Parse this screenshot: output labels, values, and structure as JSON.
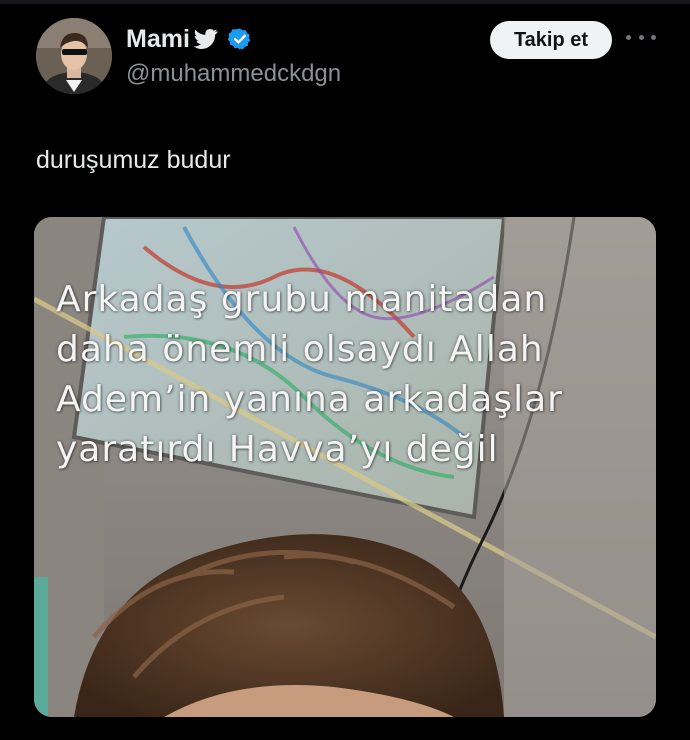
{
  "author": {
    "name": "Mami",
    "handle": "@muhammedckdgn",
    "verified": true,
    "emoji_icon": "bird-icon",
    "verified_icon": "verified-badge-icon"
  },
  "actions": {
    "follow_label": "Takip et",
    "more_icon": "more-options-icon"
  },
  "tweet": {
    "text": "duruşumuz budur",
    "media_caption_lines": [
      "Arkadaş grubu manitadan",
      "daha önemli olsaydı Allah",
      "Adem’in yanına arkadaşlar",
      "yaratırdı Havva’yı değil"
    ]
  },
  "colors": {
    "background": "#000000",
    "verified_blue": "#1d9bf0",
    "follow_button_bg": "#eff3f4",
    "secondary_text": "#8b9196"
  }
}
